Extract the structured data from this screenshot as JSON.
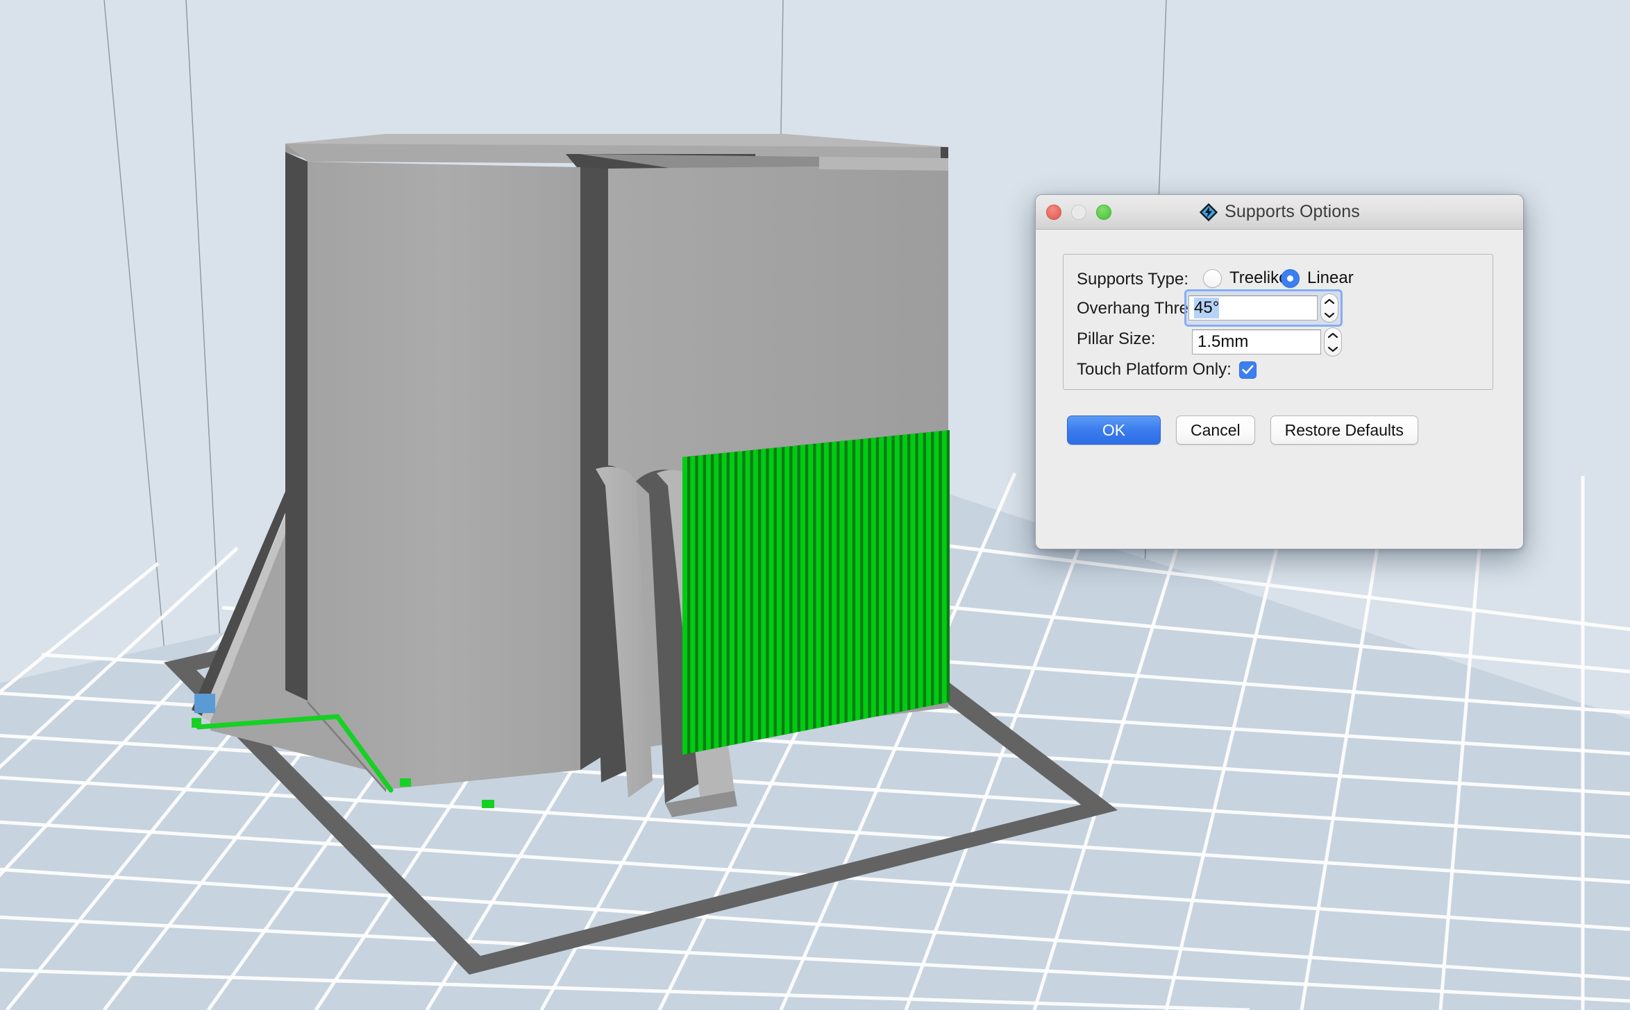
{
  "window": {
    "title": "Supports Options",
    "app_icon": "diamond-bolt-icon",
    "close_label": "",
    "minimize_label": "",
    "zoom_label": ""
  },
  "form": {
    "supports_type": {
      "label": "Supports Type:",
      "options": [
        {
          "label": "Treelike",
          "selected": false
        },
        {
          "label": "Linear",
          "selected": true
        }
      ]
    },
    "overhang_threshold": {
      "label": "Overhang Threshold:",
      "value": "45°",
      "focused": true
    },
    "pillar_size": {
      "label": "Pillar Size:",
      "value": "1.5mm",
      "focused": false
    },
    "touch_platform_only": {
      "label": "Touch Platform Only:",
      "checked": true
    }
  },
  "buttons": {
    "ok": "OK",
    "cancel": "Cancel",
    "restore": "Restore Defaults"
  },
  "viewport": {
    "description": "3D print preview showing a grey box model on a build plate with green linear supports",
    "colors": {
      "background": "#d9e2ea",
      "plate_tile": "#c6d2dd",
      "plate_grid": "#ffffff",
      "plate_border": "#636363",
      "model_light": "#b4b4b4",
      "model_mid": "#9a9a9a",
      "model_dark": "#4a4a4a",
      "support_green": "#00cc11",
      "accent_blue": "#3b7ff0"
    },
    "support_count": 34
  }
}
